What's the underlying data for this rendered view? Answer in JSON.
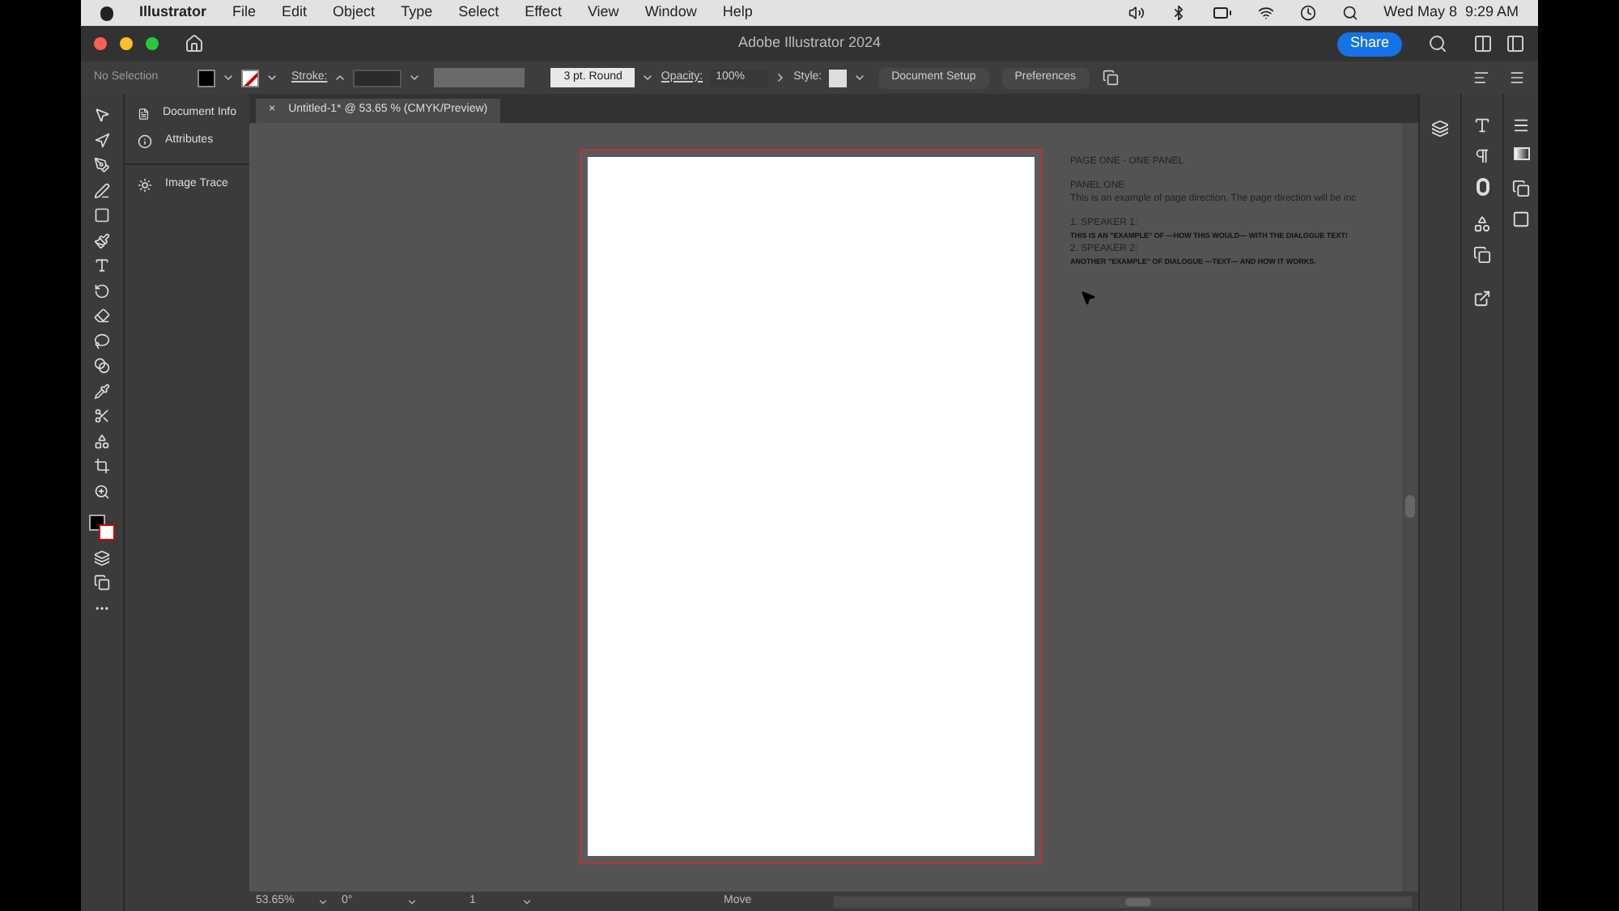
{
  "menu_bar": {
    "app": "Illustrator",
    "items": [
      "File",
      "Edit",
      "Object",
      "Type",
      "Select",
      "Effect",
      "View",
      "Window",
      "Help"
    ],
    "clock": "Wed May 8  9:29 AM"
  },
  "title_bar": {
    "title": "Adobe Illustrator 2024",
    "share": "Share"
  },
  "control_bar": {
    "selection": "No Selection",
    "stroke_label": "Stroke:",
    "brush": "3 pt. Round",
    "opacity_label": "Opacity:",
    "opacity": "100%",
    "style_label": "Style:",
    "buttons": [
      "Document Setup",
      "Preferences"
    ]
  },
  "panels": [
    {
      "label": "Document Info"
    },
    {
      "label": "Attributes"
    },
    {
      "label": "Image Trace"
    }
  ],
  "document_tab": {
    "close": "×",
    "title": "Untitled-1* @ 53.65 % (CMYK/Preview)"
  },
  "pasteboard_text": [
    {
      "kind": "heading",
      "text": "PAGE ONE - ONE PANEL"
    },
    {
      "kind": "gap"
    },
    {
      "kind": "heading",
      "text": "PANEL ONE"
    },
    {
      "kind": "body",
      "text": "This is an example of page direction. The page direction will be inc"
    },
    {
      "kind": "gap"
    },
    {
      "kind": "heading",
      "text": "1. SPEAKER 1:"
    },
    {
      "kind": "dialogue",
      "text": "THIS IS AN \"EXAMPLE\" OF —HOW THIS WOULD— WITH THE DIALOGUE TEXT!"
    },
    {
      "kind": "heading",
      "text": "2. SPEAKER 2:"
    },
    {
      "kind": "dialogue",
      "text": "ANOTHER \"EXAMPLE\" OF DIALOGUE —TEXT— AND HOW IT WORKS."
    }
  ],
  "status_bar": {
    "zoom": "53.65%",
    "rotation": "0°",
    "artboard": "1",
    "tool": "Move"
  }
}
